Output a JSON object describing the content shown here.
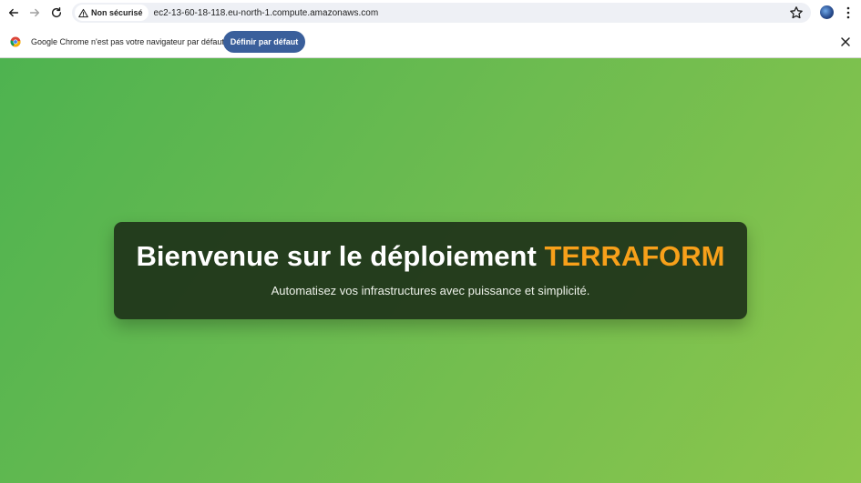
{
  "browser": {
    "security_label": "Non sécurisé",
    "url": "ec2-13-60-18-118.eu-north-1.compute.amazonaws.com"
  },
  "infobar": {
    "message": "Google Chrome n'est pas votre navigateur par défaut",
    "button_label": "Définir par défaut"
  },
  "hero": {
    "title_prefix": "Bienvenue sur le déploiement",
    "title_accent": "TERRAFORM",
    "subtitle": "Automatisez vos infrastructures avec puissance et simplicité."
  },
  "colors": {
    "accent": "#f7a01a",
    "button": "#3a5f9b",
    "card": "#1e3219",
    "gradient_start": "#4eb350",
    "gradient_end": "#8cc64c"
  },
  "icons": [
    "back-arrow-icon",
    "forward-arrow-icon",
    "reload-icon",
    "warning-icon",
    "star-icon",
    "avatar",
    "kebab-menu-icon",
    "chrome-logo-icon",
    "close-icon"
  ]
}
